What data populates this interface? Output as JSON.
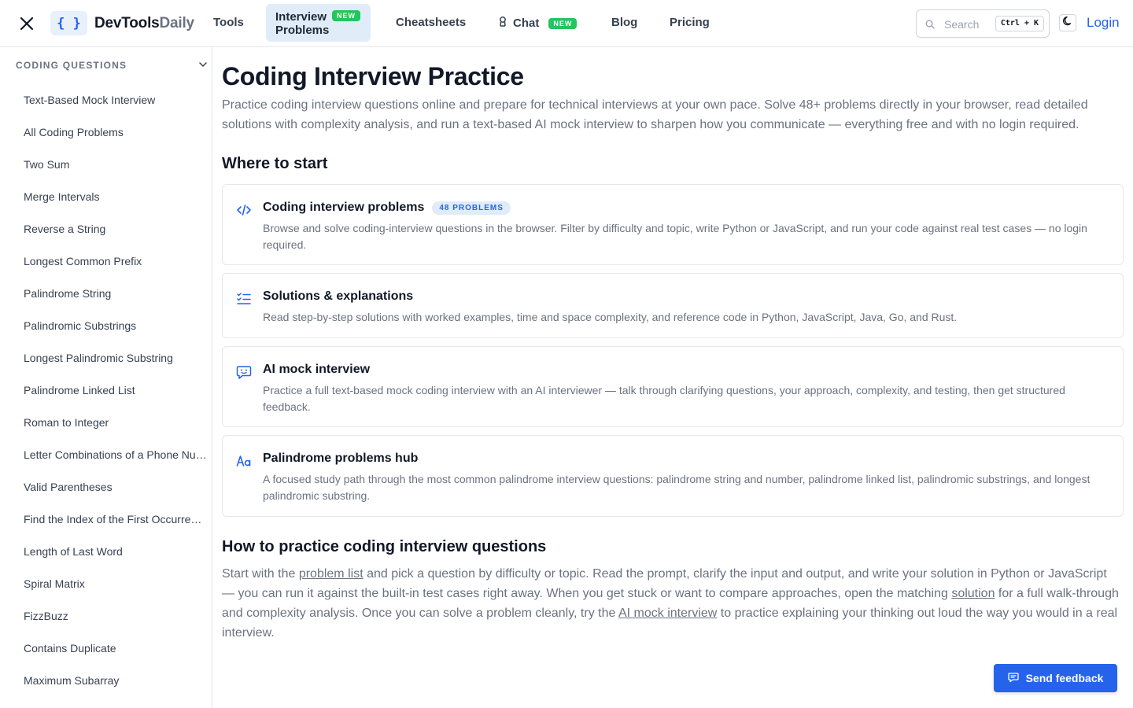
{
  "header": {
    "brand_part1": "DevTools",
    "brand_part2": "Daily",
    "logo_glyphs": "{ }",
    "nav": {
      "tools": "Tools",
      "interview_line1": "Interview",
      "interview_line2": "Problems",
      "interview_badge": "NEW",
      "cheatsheets": "Cheatsheets",
      "chat": "Chat",
      "chat_badge": "NEW",
      "blog": "Blog",
      "pricing": "Pricing"
    },
    "search": {
      "placeholder": "Search",
      "shortcut": "Ctrl + K"
    },
    "login": "Login"
  },
  "sidebar": {
    "section_title": "CODING QUESTIONS",
    "items": [
      "Text-Based Mock Interview",
      "All Coding Problems",
      "Two Sum",
      "Merge Intervals",
      "Reverse a String",
      "Longest Common Prefix",
      "Palindrome String",
      "Palindromic Substrings",
      "Longest Palindromic Substring",
      "Palindrome Linked List",
      "Roman to Integer",
      "Letter Combinations of a Phone Number",
      "Valid Parentheses",
      "Find the Index of the First Occurrence in a String",
      "Length of Last Word",
      "Spiral Matrix",
      "FizzBuzz",
      "Contains Duplicate",
      "Maximum Subarray"
    ]
  },
  "main": {
    "title": "Coding Interview Practice",
    "intro": "Practice coding interview questions online and prepare for technical interviews at your own pace. Solve 48+ problems directly in your browser, read detailed solutions with complexity analysis, and run a text-based AI mock interview to sharpen how you communicate — everything free and with no login required.",
    "where_heading": "Where to start",
    "cards": [
      {
        "icon": "code-icon",
        "title": "Coding interview problems",
        "badge": "48 PROBLEMS",
        "desc": "Browse and solve coding-interview questions in the browser. Filter by difficulty and topic, write Python or JavaScript, and run your code against real test cases — no login required."
      },
      {
        "icon": "list-checks-icon",
        "title": "Solutions & explanations",
        "desc": "Read step-by-step solutions with worked examples, time and space complexity, and reference code in Python, JavaScript, Java, Go, and Rust."
      },
      {
        "icon": "chat-bot-icon",
        "title": "AI mock interview",
        "desc": "Practice a full text-based mock coding interview with an AI interviewer — talk through clarifying questions, your approach, complexity, and testing, then get structured feedback."
      },
      {
        "icon": "text-case-icon",
        "title": "Palindrome problems hub",
        "desc": "A focused study path through the most common palindrome interview questions: palindrome string and number, palindrome linked list, palindromic substrings, and longest palindromic substring."
      }
    ],
    "how_heading": "How to practice coding interview questions",
    "how": {
      "p1": "Start with the ",
      "link1": "problem list",
      "p2": " and pick a question by difficulty or topic. Read the prompt, clarify the input and output, and write your solution in Python or JavaScript — you can run it against the built-in test cases right away. When you get stuck or want to compare approaches, open the matching ",
      "link2": "solution",
      "p3": " for a full walk-through and complexity analysis. Once you can solve a problem cleanly, try the ",
      "link3": "AI mock interview",
      "p4": " to practice explaining your thinking out loud the way you would in a real interview."
    }
  },
  "feedback_button": "Send feedback",
  "colors": {
    "accent": "#2563eb",
    "badge_green": "#22c55e",
    "pill_bg": "#e0ecf8"
  }
}
